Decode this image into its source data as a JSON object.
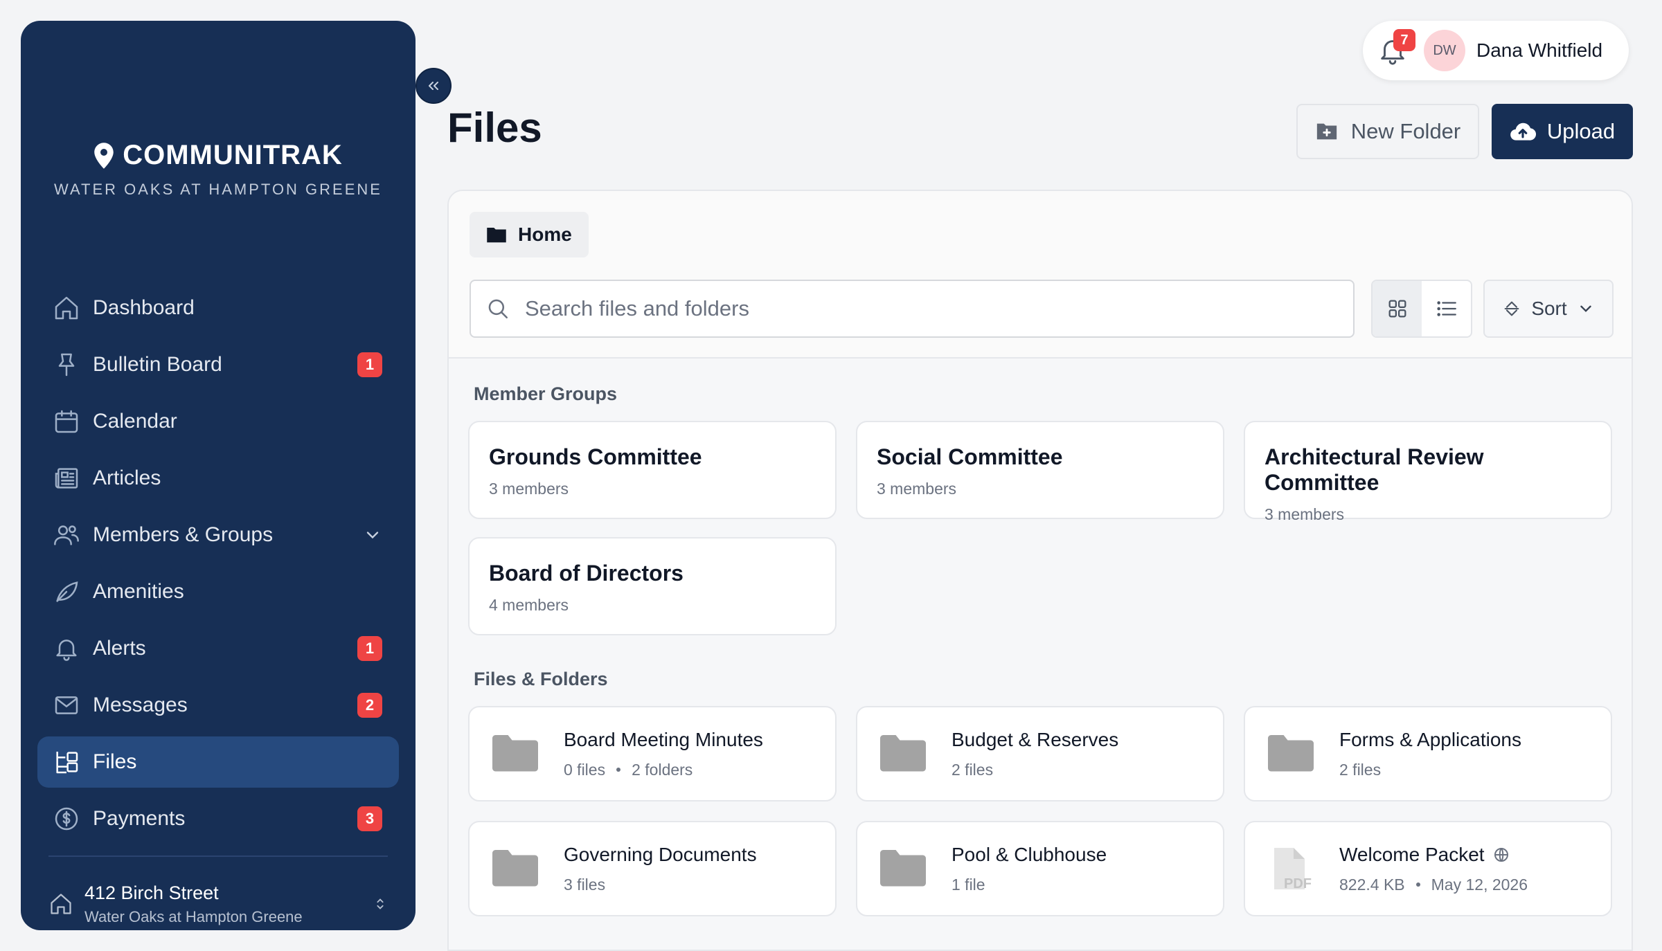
{
  "brand": {
    "name": "COMMUNITRAK",
    "subtitle": "WATER OAKS AT HAMPTON GREENE"
  },
  "nav": [
    {
      "label": "Dashboard",
      "icon": "home-icon",
      "badge": ""
    },
    {
      "label": "Bulletin Board",
      "icon": "pin-icon",
      "badge": "1"
    },
    {
      "label": "Calendar",
      "icon": "calendar-icon",
      "badge": ""
    },
    {
      "label": "Articles",
      "icon": "newspaper-icon",
      "badge": ""
    },
    {
      "label": "Members & Groups",
      "icon": "users-icon",
      "badge": ""
    },
    {
      "label": "Amenities",
      "icon": "leaf-icon",
      "badge": ""
    },
    {
      "label": "Alerts",
      "icon": "bell-icon",
      "badge": "1"
    },
    {
      "label": "Messages",
      "icon": "mail-icon",
      "badge": "2"
    },
    {
      "label": "Files",
      "icon": "files-icon",
      "badge": "",
      "active": true
    },
    {
      "label": "Payments",
      "icon": "dollar-icon",
      "badge": "3"
    }
  ],
  "address": {
    "line1": "412 Birch Street",
    "line2": "Water Oaks at Hampton Greene"
  },
  "user": {
    "notifications": "7",
    "initials": "DW",
    "name": "Dana Whitfield"
  },
  "page": {
    "title": "Files",
    "new_folder_label": "New Folder",
    "upload_label": "Upload"
  },
  "breadcrumb": {
    "home": "Home"
  },
  "search": {
    "placeholder": "Search files and folders",
    "value": ""
  },
  "sort": {
    "label": "Sort"
  },
  "member_groups": {
    "label": "Member Groups",
    "items": [
      {
        "name": "Grounds Committee",
        "members": "3 members"
      },
      {
        "name": "Social Committee",
        "members": "3 members"
      },
      {
        "name": "Architectural Review Committee",
        "members": "3 members"
      },
      {
        "name": "Board of Directors",
        "members": "4 members"
      }
    ]
  },
  "files_folders": {
    "label": "Files & Folders",
    "items": [
      {
        "name": "Board Meeting Minutes",
        "meta1": "0 files",
        "meta2": "2 folders",
        "type": "folder"
      },
      {
        "name": "Budget & Reserves",
        "meta1": "2 files",
        "meta2": "",
        "type": "folder"
      },
      {
        "name": "Forms & Applications",
        "meta1": "2 files",
        "meta2": "",
        "type": "folder"
      },
      {
        "name": "Governing Documents",
        "meta1": "3 files",
        "meta2": "",
        "type": "folder"
      },
      {
        "name": "Pool & Clubhouse",
        "meta1": "1 file",
        "meta2": "",
        "type": "folder"
      },
      {
        "name": "Welcome Packet",
        "meta1": "822.4 KB",
        "meta2": "May 12, 2026",
        "type": "pdf",
        "pdf_label": "PDF"
      }
    ]
  },
  "colors": {
    "sidebar": "#172f55",
    "active_nav": "#264a7e",
    "badge": "#ef4444",
    "primary_button": "#172f55"
  }
}
